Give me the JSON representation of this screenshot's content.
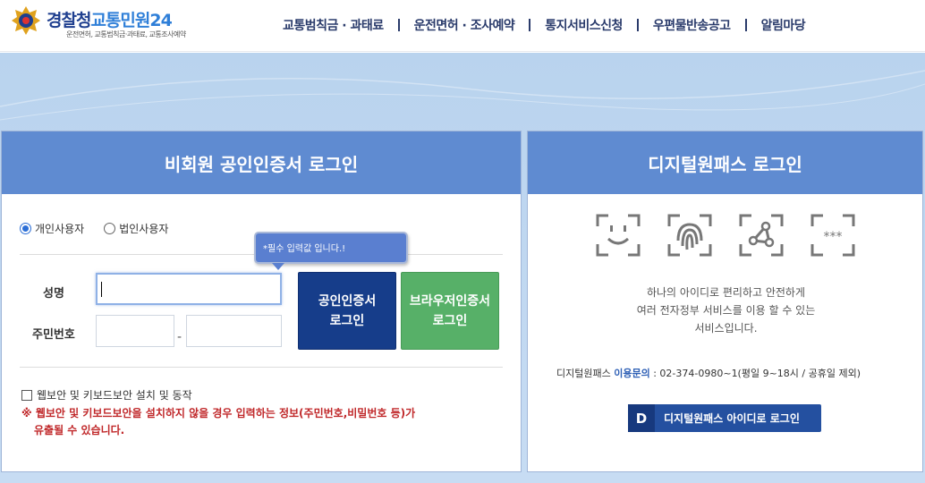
{
  "header": {
    "logo_police": "경찰청",
    "logo_service": "교통민원24",
    "logo_sub": "운전면허, 교통범칙금·과태료, 교통조사예약",
    "nav": [
      "교통범칙금 · 과태료",
      "운전면허 · 조사예약",
      "통지서비스신청",
      "우편물반송공고",
      "알림마당"
    ]
  },
  "left": {
    "title": "비회원 공인인증서 로그인",
    "radios": [
      {
        "label": "개인사용자",
        "checked": true
      },
      {
        "label": "법인사용자",
        "checked": false
      }
    ],
    "tooltip": "*필수 입력값 입니다.!",
    "name_label": "성명",
    "rrn_label": "주민번호",
    "rrn_sep": "-",
    "btn_cert_line1": "공인인증서",
    "btn_cert_line2": "로그인",
    "btn_browser_line1": "브라우저인증서",
    "btn_browser_line2": "로그인",
    "security_check": "웹보안 및 키보드보안 설치 및 동작",
    "warning_line1": "※ 웹보안 및 키보드보안을 설치하지 않을 경우 입력하는 정보(주민번호,비밀번호 등)가",
    "warning_line2": "유출될 수 있습니다."
  },
  "right": {
    "title": "디지털원패스 로그인",
    "icons": [
      "face-icon",
      "fingerprint-icon",
      "pattern-icon",
      "password-icon"
    ],
    "desc_line1": "하나의 아이디로 편리하고 안전하게",
    "desc_line2": "여러 전자정부 서비스를 이용 할 수 있는",
    "desc_line3": "서비스입니다.",
    "inquiry_prefix": "디지털원패스",
    "inquiry_label": "이용문의",
    "inquiry_text": ": 02-374-0980~1(평일 9~18시 / 공휴일 제외)",
    "login_badge": "D",
    "login_btn": "디지털원패스 아이디로 로그인"
  },
  "colors": {
    "panel_head": "#5f8bd1",
    "btn_navy": "#163d8a",
    "btn_green": "#57b068",
    "warning": "#c0282a"
  }
}
